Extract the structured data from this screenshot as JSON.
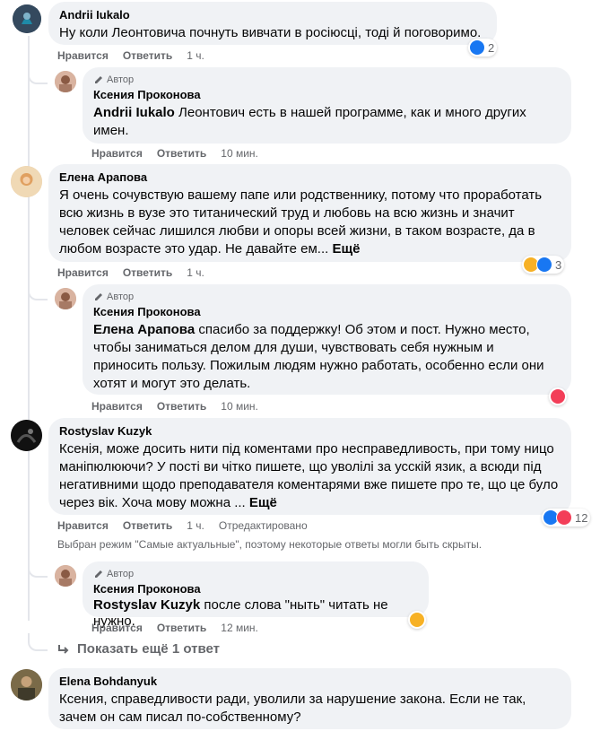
{
  "badge_author": "Автор",
  "labels": {
    "like": "Нравится",
    "reply": "Ответить"
  },
  "comments": [
    {
      "author": "Andrii Iukalo",
      "text": "Ну коли Леонтовича почнуть вивчати в росіюсці, тоді й поговоримо.",
      "time": "1 ч.",
      "reaction_count": "2",
      "reactions": [
        "like"
      ]
    },
    {
      "author": "Ксения Проконова",
      "mention": "Andrii Iukalo",
      "text": " Леонтович есть в нашей программе, как и много других имен.",
      "time": "10 мин."
    },
    {
      "author": "Елена Арапова",
      "text": "Я очень сочувствую вашему папе или родственнику, потому что проработать всю жизнь в вузе это титанический труд и любовь на всю жизнь и значит человек сейчас лишился любви и опоры всей жизни, в таком возрасте, да в любом возрасте это удар. Не давайте ем...",
      "more": "Ещё",
      "time": "1 ч.",
      "reaction_count": "3",
      "reactions": [
        "haha",
        "like"
      ]
    },
    {
      "author": "Ксения Проконова",
      "mention": "Елена Арапова",
      "text": " спасибо за поддержку! Об этом и пост. Нужно место, чтобы заниматься делом для души, чувствовать себя нужным и приносить пользу. Пожилым людям нужно работать, особенно если они хотят и могут это делать.",
      "time": "10 мин.",
      "reactions": [
        "love"
      ]
    },
    {
      "author": "Rostyslav Kuzyk",
      "text": "Ксенія, може досить нити під коментами про несправедливость, при тому ницо маніпюлюючи? У пості ви чітко пишете, що уволілі за усскій язик, а всюди під негативними щодо преподавателя коментарями вже пишете про те, що це було через вік. Хоча мову можна ...",
      "more": "Ещё",
      "time": "1 ч.",
      "edited": "Отредактировано",
      "reaction_count": "12",
      "reactions": [
        "like",
        "love"
      ]
    },
    {
      "author": "Ксения Проконова",
      "mention": "Rostyslav Kuzyk",
      "text": " после слова \"ныть\" читать не нужно.",
      "time": "12 мин.",
      "reactions": [
        "haha"
      ]
    },
    {
      "author": "Elena Bohdanyuk",
      "text": "Ксения, справедливости ради, уволили за нарушение закона. Если не так, зачем он сам писал по-собственному?"
    }
  ],
  "notice": "Выбран режим \"Самые актуальные\", поэтому некоторые ответы могли быть скрыты.",
  "show_more": "Показать ещё 1 ответ"
}
